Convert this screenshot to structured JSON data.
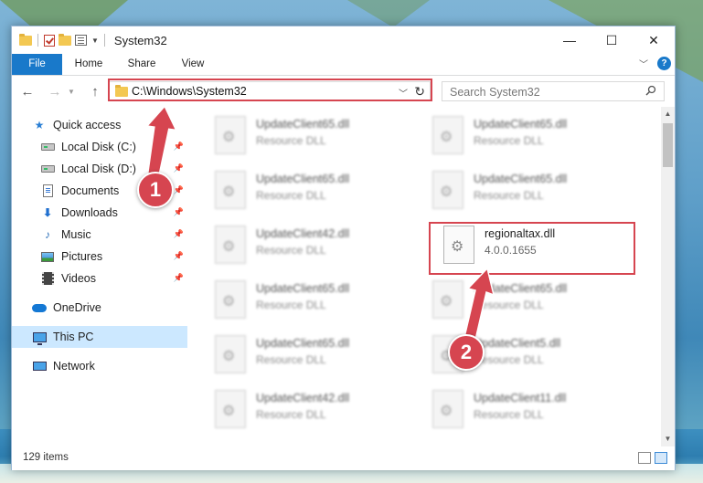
{
  "window": {
    "title": "System32",
    "controls": {
      "minimize": "—",
      "maximize": "☐",
      "close": "✕"
    }
  },
  "ribbon": {
    "tabs": [
      {
        "label": "File",
        "active": true
      },
      {
        "label": "Home"
      },
      {
        "label": "Share"
      },
      {
        "label": "View"
      }
    ],
    "expand_icon": "chevron-down-icon",
    "help_icon": "?"
  },
  "nav": {
    "back": "←",
    "forward": "→",
    "up": "↑",
    "address": "C:\\Windows\\System32",
    "refresh": "↻",
    "search_placeholder": "Search System32"
  },
  "sidebar": {
    "items": [
      {
        "label": "Quick access",
        "icon": "star-icon"
      },
      {
        "label": "Local Disk (C:)",
        "icon": "drive-icon",
        "pinned": true
      },
      {
        "label": "Local Disk (D:)",
        "icon": "drive-icon",
        "pinned": true
      },
      {
        "label": "Documents",
        "icon": "documents-icon",
        "pinned": true
      },
      {
        "label": "Downloads",
        "icon": "download-icon",
        "pinned": true
      },
      {
        "label": "Music",
        "icon": "music-icon",
        "pinned": true
      },
      {
        "label": "Pictures",
        "icon": "pictures-icon",
        "pinned": true
      },
      {
        "label": "Videos",
        "icon": "videos-icon",
        "pinned": true
      },
      {
        "label": "OneDrive",
        "icon": "cloud-icon"
      },
      {
        "label": "This PC",
        "icon": "computer-icon",
        "selected": true
      },
      {
        "label": "Network",
        "icon": "network-icon"
      }
    ]
  },
  "files": [
    {
      "name": "UpdateClient65.dll",
      "type": "Resource DLL"
    },
    {
      "name": "UpdateClient65.dll",
      "type": "Resource DLL"
    },
    {
      "name": "UpdateClient65.dll",
      "type": "Resource DLL"
    },
    {
      "name": "UpdateClient65.dll",
      "type": "Resource DLL"
    },
    {
      "name": "UpdateClient42.dll",
      "type": "Resource DLL"
    },
    {
      "name": "regionaltax.dll",
      "type": "4.0.0.1655"
    },
    {
      "name": "UpdateClient65.dll",
      "type": "Resource DLL"
    },
    {
      "name": "UpdateClient65.dll",
      "type": "Resource DLL"
    },
    {
      "name": "UpdateClient65.dll",
      "type": "Resource DLL"
    },
    {
      "name": "UpdateClient5.dll",
      "type": "Resource DLL"
    },
    {
      "name": "UpdateClient42.dll",
      "type": "Resource DLL"
    },
    {
      "name": "UpdateClient11.dll",
      "type": "Resource DLL"
    }
  ],
  "status": {
    "item_count": "129 items"
  },
  "annotations": {
    "marker1": "1",
    "marker2": "2",
    "color": "#d64550"
  }
}
